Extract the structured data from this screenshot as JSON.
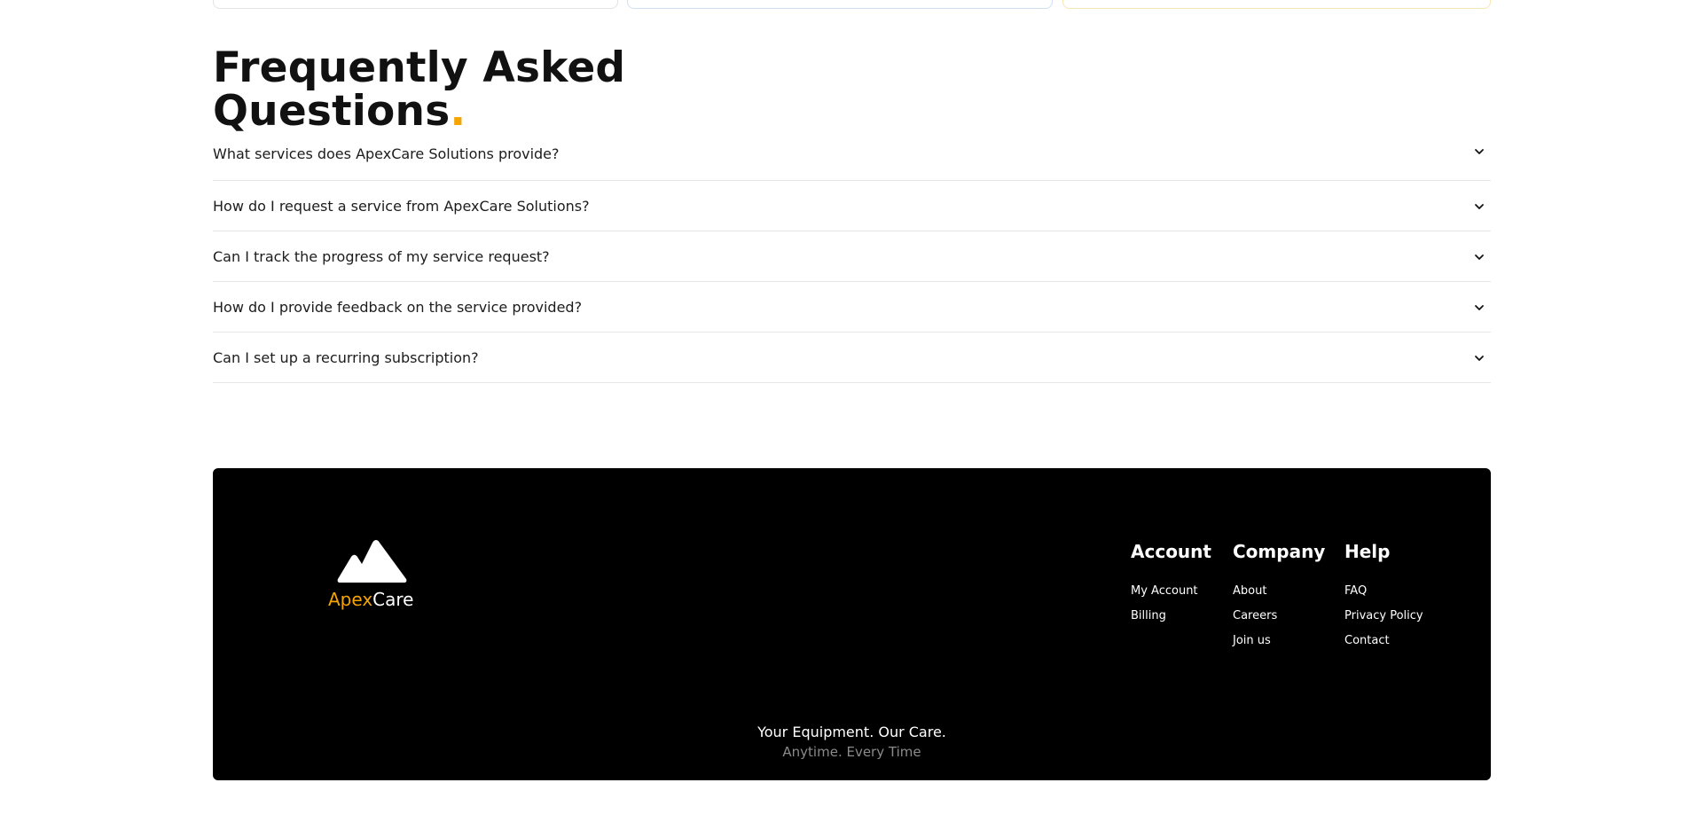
{
  "faq": {
    "title_line1": "Frequently Asked",
    "title_line2": "Questions",
    "title_dot": ".",
    "accent_color": "#f5a400",
    "items": [
      {
        "question": "What services does ApexCare Solutions provide?",
        "icon": "chevron-down-icon"
      },
      {
        "question": "How do I request a service from ApexCare Solutions?",
        "icon": "chevron-down-icon"
      },
      {
        "question": "Can I track the progress of my service request?",
        "icon": "chevron-down-icon"
      },
      {
        "question": "How do I provide feedback on the service provided?",
        "icon": "chevron-down-icon"
      },
      {
        "question": "Can I set up a recurring subscription?",
        "icon": "chevron-down-icon"
      }
    ]
  },
  "footer": {
    "background": "#000000",
    "logo": {
      "icon": "mountain-logo-icon",
      "apex": "Apex",
      "care": "Care",
      "apex_color": "#f5a400"
    },
    "columns": [
      {
        "title": "Account",
        "links": [
          "My Account",
          "Billing"
        ]
      },
      {
        "title": "Company",
        "links": [
          "About",
          "Careers",
          "Join us"
        ]
      },
      {
        "title": "Help",
        "links": [
          "FAQ",
          "Privacy Policy",
          "Contact"
        ]
      }
    ],
    "tagline_main": "Your Equipment. Our Care.",
    "tagline_sub": "Anytime. Every Time"
  }
}
